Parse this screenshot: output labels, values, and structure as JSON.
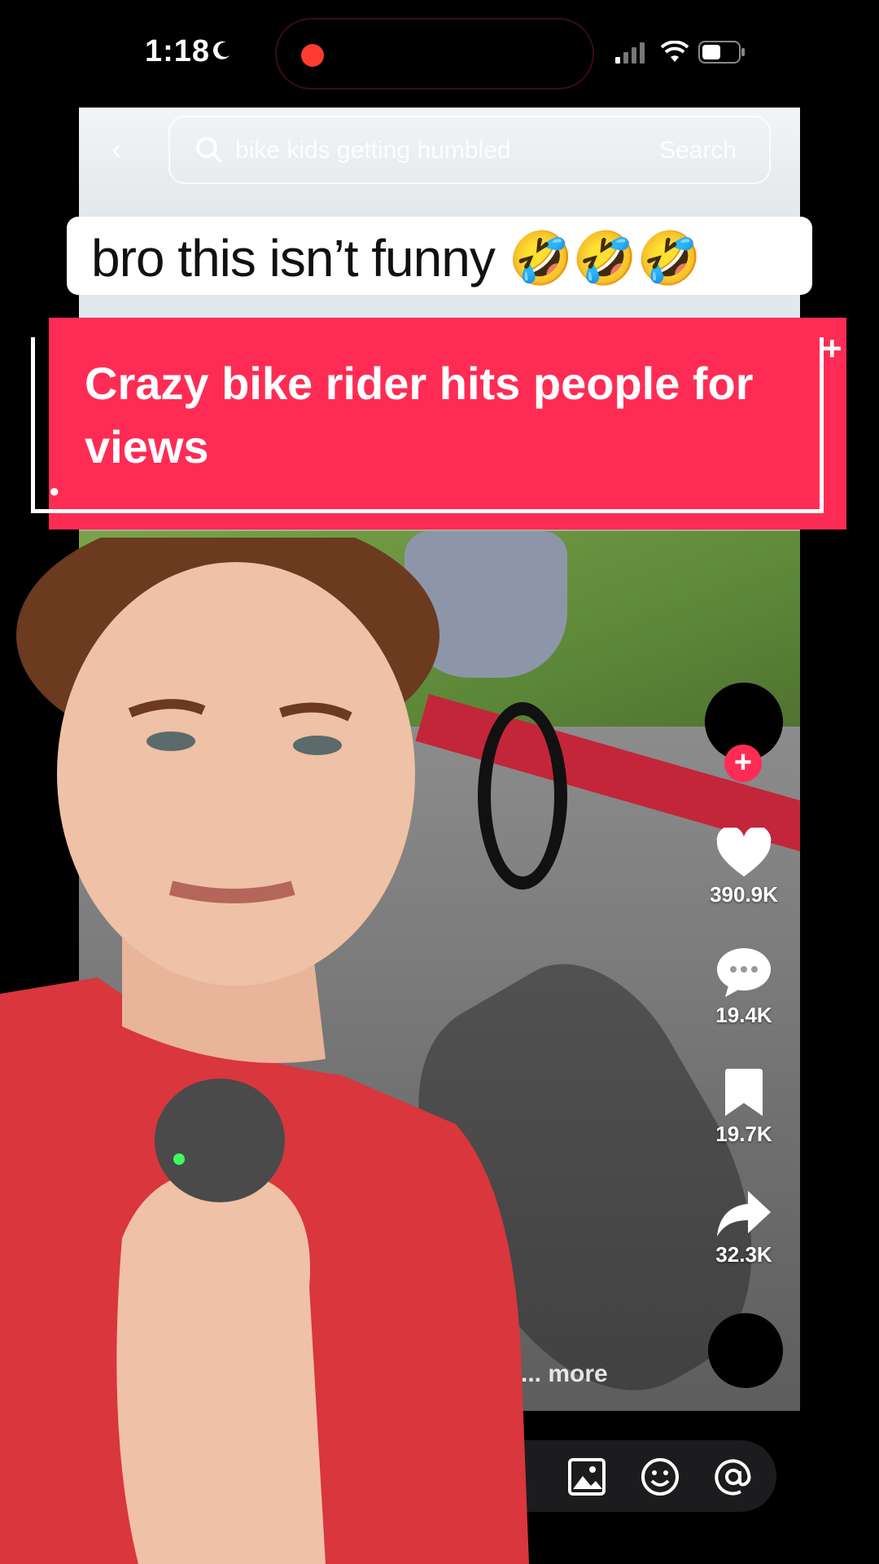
{
  "status_bar": {
    "time": "1:18"
  },
  "inner_screen": {
    "search_placeholder": "bike kids getting humbled",
    "search_button": "Search",
    "more_label": "... more",
    "actions": [
      {
        "icon": "heart-icon",
        "count": "390.9K"
      },
      {
        "icon": "comment-icon",
        "count": "19.4K"
      },
      {
        "icon": "bookmark-icon",
        "count": "19.7K"
      },
      {
        "icon": "share-icon",
        "count": "32.3K"
      }
    ],
    "follow_label": "+"
  },
  "captions": {
    "white": "bro this isn’t funny 🤣🤣🤣",
    "red": "Crazy bike rider hits people for views"
  },
  "colors": {
    "accent": "#fe2c55",
    "shirt": "#d9363e"
  }
}
